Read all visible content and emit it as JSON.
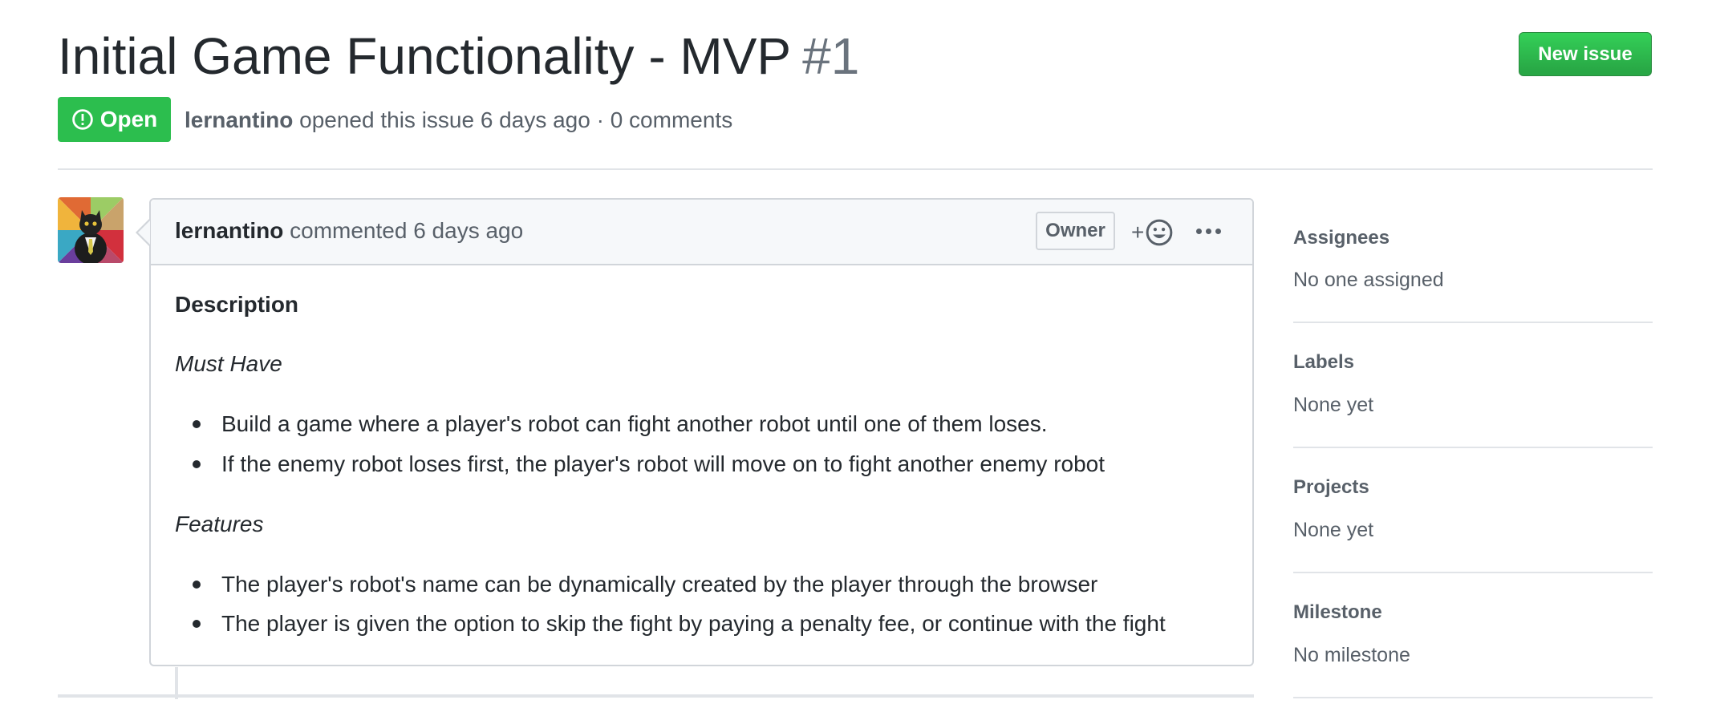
{
  "issue": {
    "title": "Initial Game Functionality - MVP",
    "number": "#1",
    "state": "Open",
    "author": "lernantino",
    "opened_text": "opened this issue 6 days ago · 0 comments"
  },
  "header": {
    "new_issue_label": "New issue"
  },
  "comment": {
    "author": "lernantino",
    "action_text": "commented 6 days ago",
    "role_badge": "Owner",
    "reaction_plus": "+",
    "body": {
      "heading": "Description",
      "must_have_heading": "Must Have",
      "must_have_items": [
        "Build a game where a player's robot can fight another robot until one of them loses.",
        "If the enemy robot loses first, the player's robot will move on to fight another enemy robot"
      ],
      "features_heading": "Features",
      "features_items": [
        "The player's robot's name can be dynamically created by the player through the browser",
        "The player is given the option to skip the fight by paying a penalty fee, or continue with the fight"
      ]
    }
  },
  "sidebar": {
    "assignees": {
      "label": "Assignees",
      "value": "No one assigned"
    },
    "labels": {
      "label": "Labels",
      "value": "None yet"
    },
    "projects": {
      "label": "Projects",
      "value": "None yet"
    },
    "milestone": {
      "label": "Milestone",
      "value": "No milestone"
    }
  },
  "icons": {
    "state": "issue-opened-icon",
    "reaction": "smiley-icon",
    "more": "kebab-horizontal-icon"
  },
  "colors": {
    "open_green": "#2cbe4e",
    "new_issue_green": "#28a745",
    "text": "#24292e",
    "muted": "#586069",
    "border": "#d1d5da"
  }
}
